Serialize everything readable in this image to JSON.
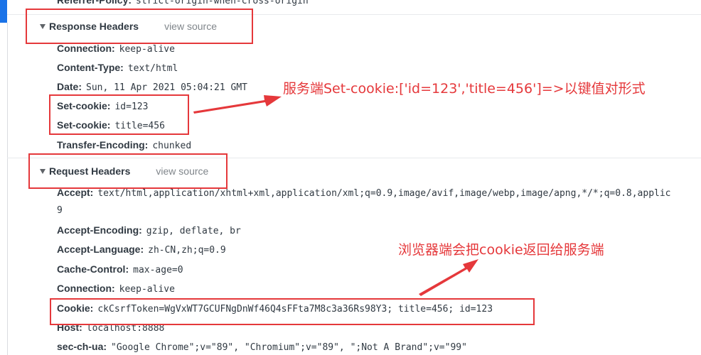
{
  "partial_top_row": {
    "name": "Referrer-Policy:",
    "value": "strict-origin-when-cross-origin"
  },
  "response_headers": {
    "title": "Response Headers",
    "view_source": "view source",
    "rows": [
      {
        "name": "Connection:",
        "value": "keep-alive"
      },
      {
        "name": "Content-Type:",
        "value": "text/html"
      },
      {
        "name": "Date:",
        "value": "Sun, 11 Apr 2021 05:04:21 GMT"
      },
      {
        "name": "Set-cookie:",
        "value": "id=123"
      },
      {
        "name": "Set-cookie:",
        "value": "title=456"
      },
      {
        "name": "Transfer-Encoding:",
        "value": "chunked"
      }
    ]
  },
  "request_headers": {
    "title": "Request Headers",
    "view_source": "view source",
    "rows": [
      {
        "name": "Accept:",
        "value": "text/html,application/xhtml+xml,application/xml;q=0.9,image/avif,image/webp,image/apng,*/*;q=0.8,applic"
      },
      {
        "name": "",
        "value": "9"
      },
      {
        "name": "Accept-Encoding:",
        "value": "gzip, deflate, br"
      },
      {
        "name": "Accept-Language:",
        "value": "zh-CN,zh;q=0.9"
      },
      {
        "name": "Cache-Control:",
        "value": "max-age=0"
      },
      {
        "name": "Connection:",
        "value": "keep-alive"
      },
      {
        "name": "Cookie:",
        "value": "ckCsrfToken=WgVxWT7GCUFNgDnWf46Q4sFFta7M8c3a36Rs98Y3; title=456; id=123"
      },
      {
        "name": "Host:",
        "value": "localhost:8888"
      },
      {
        "name": "sec-ch-ua:",
        "value": "\"Google Chrome\";v=\"89\", \"Chromium\";v=\"89\", \";Not A Brand\";v=\"99\""
      }
    ]
  },
  "annotations": {
    "server_note": "服务端Set-cookie:['id=123','title=456']=>以键值对形式",
    "browser_note": "浏览器端会把cookie返回给服务端"
  },
  "colors": {
    "annotation": "#e5383b",
    "accent": "#1a73e8"
  }
}
